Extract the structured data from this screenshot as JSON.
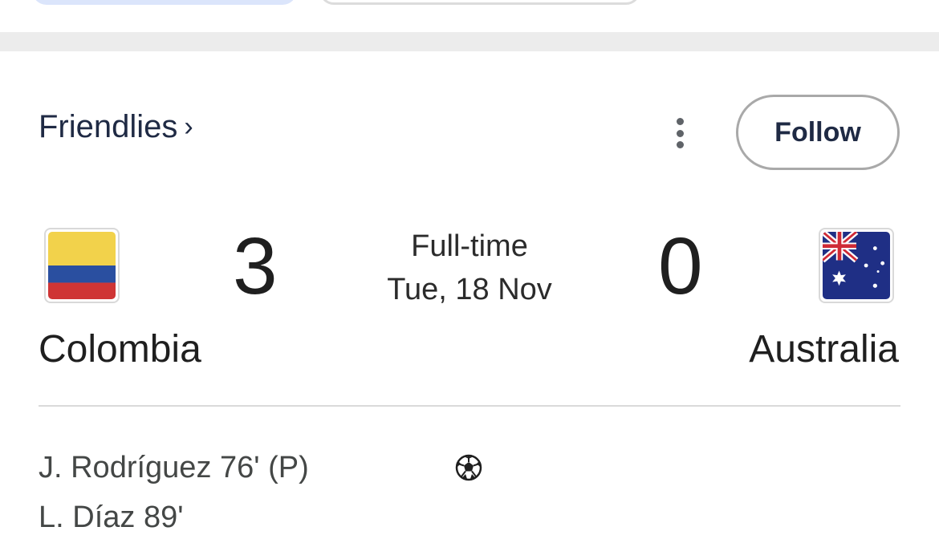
{
  "colors": {
    "accent_chip": "#dbe5fb",
    "text_primary": "#1f1f1f",
    "text_link": "#1f2a44",
    "divider": "#dadada",
    "colombia_yellow": "#f2d24b",
    "colombia_blue": "#2a4fa0",
    "colombia_red": "#cf3535",
    "australia_blue": "#1f2f85"
  },
  "header": {
    "competition": "Friendlies",
    "competition_chevron": "›",
    "more_icon": "more-vert-icon",
    "follow_label": "Follow"
  },
  "match": {
    "home": {
      "name": "Colombia",
      "score": "3",
      "flag_icon": "colombia-flag-icon"
    },
    "away": {
      "name": "Australia",
      "score": "0",
      "flag_icon": "australia-flag-icon"
    },
    "status": "Full-time",
    "date": "Tue, 18 Nov"
  },
  "goals": {
    "icon": "soccer-ball-icon",
    "home_scorers": [
      "J. Rodríguez 76' (P)",
      "L. Díaz 89'"
    ]
  }
}
